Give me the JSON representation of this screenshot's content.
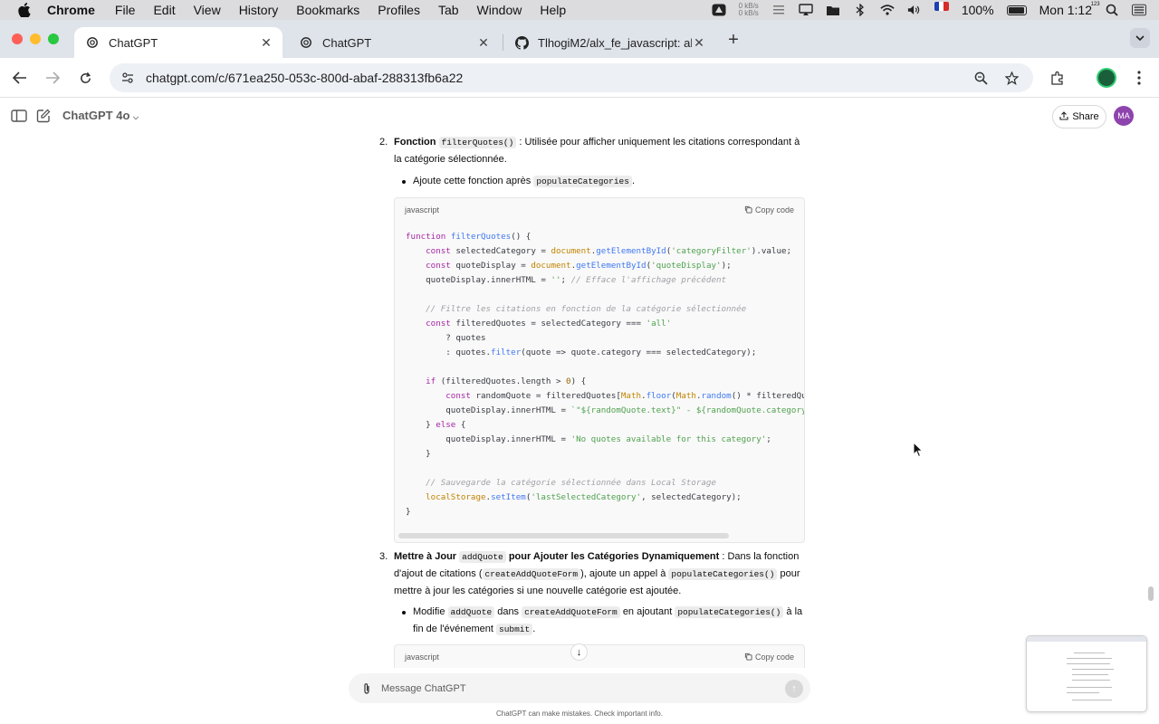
{
  "menubar": {
    "app_name": "Chrome",
    "menus": [
      "File",
      "Edit",
      "View",
      "History",
      "Bookmarks",
      "Profiles",
      "Tab",
      "Window",
      "Help"
    ],
    "net_up": "0 kB/s",
    "net_down": "0 kB/s",
    "input_source_number": "123",
    "battery": "100%",
    "clock": "Mon 1:12"
  },
  "tabs": [
    {
      "title": "ChatGPT",
      "active": true
    },
    {
      "title": "ChatGPT",
      "active": false
    },
    {
      "title": "TlhogiM2/alx_fe_javascript: al",
      "active": false
    }
  ],
  "address_bar": {
    "url": "chatgpt.com/c/671ea250-053c-800d-abaf-288313fb6a22"
  },
  "chat_header": {
    "model": "ChatGPT 4o",
    "share_label": "Share",
    "avatar_initials": "MA"
  },
  "message": {
    "item2": {
      "number": "2.",
      "lead_bold": "Fonction",
      "lead_code": "filterQuotes()",
      "lead_rest": ": Utilisée pour afficher uniquement les citations correspondant à la catégorie sélectionnée.",
      "bullet_text_1": "Ajoute cette fonction après",
      "bullet_code": "populateCategories",
      "bullet_text_2": "."
    },
    "codeblock1": {
      "language": "javascript",
      "copy_label": "Copy code"
    },
    "item3": {
      "number": "3.",
      "lead_bold_1": "Mettre à Jour",
      "lead_code": "addQuote",
      "lead_bold_2": "pour Ajouter les Catégories Dynamiquement",
      "text_1": ": Dans la fonction d'ajout de citations (",
      "code_2": "createAddQuoteForm",
      "text_2": "), ajoute un appel à",
      "code_3": "populateCategories()",
      "text_3": "pour mettre à jour les catégories si une nouvelle catégorie est ajoutée.",
      "bullet_text_1": "Modifie",
      "bullet_code_1": "addQuote",
      "bullet_text_2": "dans",
      "bullet_code_2": "createAddQuoteForm",
      "bullet_text_3": "en ajoutant",
      "bullet_code_3": "populateCategories()",
      "bullet_text_4": "à la fin de l'événement",
      "bullet_code_4": "submit",
      "bullet_text_5": "."
    },
    "codeblock2": {
      "language": "javascript",
      "copy_label": "Copy code"
    }
  },
  "composer": {
    "placeholder": "Message ChatGPT",
    "disclaimer": "ChatGPT can make mistakes. Check important info."
  },
  "colors": {
    "menubar_bg": "#dcdcde",
    "tabstrip_bg": "#dfe3ea",
    "omnibox_bg": "#edf0f5",
    "avatar_bg": "#8e44ad",
    "code_keyword": "#a626a4",
    "code_function": "#4078f2",
    "code_string": "#50a14f",
    "code_comment": "#a0a1a7"
  }
}
